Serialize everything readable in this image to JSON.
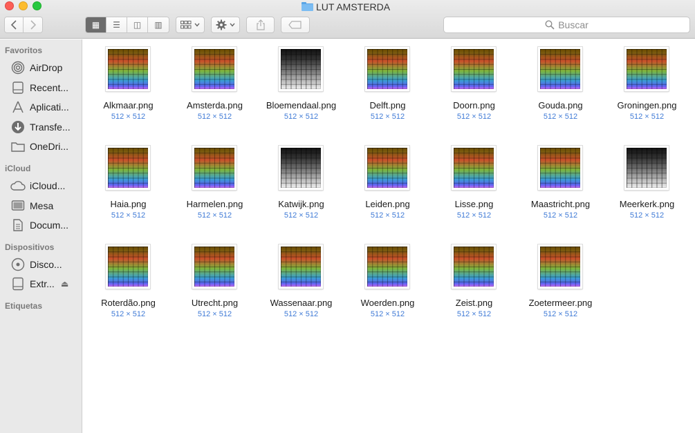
{
  "window": {
    "title": "LUT AMSTERDA",
    "folder_icon": "folder-icon"
  },
  "toolbar": {
    "back_icon": "chevron-left-icon",
    "forward_icon": "chevron-right-icon",
    "view_modes": [
      {
        "name": "icon-view",
        "glyph": "▦",
        "active": true
      },
      {
        "name": "list-view",
        "glyph": "☰",
        "active": false
      },
      {
        "name": "column-view",
        "glyph": "◫",
        "active": false
      },
      {
        "name": "cover-flow-view",
        "glyph": "▥",
        "active": false
      }
    ],
    "arrange_icon": "arrange-icon",
    "action_icon": "gear-icon",
    "share_icon": "share-icon",
    "tag_icon": "tag-icon",
    "search_placeholder": "Buscar",
    "search_icon": "search-icon"
  },
  "sidebar": {
    "sections": [
      {
        "label": "Favoritos",
        "items": [
          {
            "label": "AirDrop",
            "icon": "airdrop-icon"
          },
          {
            "label": "Recent...",
            "icon": "recents-icon"
          },
          {
            "label": "Aplicati...",
            "icon": "applications-icon"
          },
          {
            "label": "Transfe...",
            "icon": "downloads-icon"
          },
          {
            "label": "OneDri...",
            "icon": "folder-icon"
          }
        ]
      },
      {
        "label": "iCloud",
        "items": [
          {
            "label": "iCloud...",
            "icon": "cloud-icon"
          },
          {
            "label": "Mesa",
            "icon": "desktop-icon"
          },
          {
            "label": "Docum...",
            "icon": "documents-icon"
          }
        ]
      },
      {
        "label": "Dispositivos",
        "items": [
          {
            "label": "Disco...",
            "icon": "disk-icon"
          },
          {
            "label": "Extr...",
            "icon": "external-drive-icon",
            "eject": "⏏"
          }
        ]
      },
      {
        "label": "Etiquetas",
        "items": []
      }
    ]
  },
  "files": [
    {
      "name": "Alkmaar.png",
      "dims": "512 × 512",
      "tone": "color"
    },
    {
      "name": "Amsterda.png",
      "dims": "512 × 512",
      "tone": "color"
    },
    {
      "name": "Bloemendaal.png",
      "dims": "512 × 512",
      "tone": "gray"
    },
    {
      "name": "Delft.png",
      "dims": "512 × 512",
      "tone": "color"
    },
    {
      "name": "Doorn.png",
      "dims": "512 × 512",
      "tone": "color"
    },
    {
      "name": "Gouda.png",
      "dims": "512 × 512",
      "tone": "color"
    },
    {
      "name": "Groningen.png",
      "dims": "512 × 512",
      "tone": "color"
    },
    {
      "name": "Haia.png",
      "dims": "512 × 512",
      "tone": "color"
    },
    {
      "name": "Harmelen.png",
      "dims": "512 × 512",
      "tone": "color"
    },
    {
      "name": "Katwijk.png",
      "dims": "512 × 512",
      "tone": "gray"
    },
    {
      "name": "Leiden.png",
      "dims": "512 × 512",
      "tone": "color"
    },
    {
      "name": "Lisse.png",
      "dims": "512 × 512",
      "tone": "color"
    },
    {
      "name": "Maastricht.png",
      "dims": "512 × 512",
      "tone": "color"
    },
    {
      "name": "Meerkerk.png",
      "dims": "512 × 512",
      "tone": "gray"
    },
    {
      "name": "Roterdão.png",
      "dims": "512 × 512",
      "tone": "color"
    },
    {
      "name": "Utrecht.png",
      "dims": "512 × 512",
      "tone": "color"
    },
    {
      "name": "Wassenaar.png",
      "dims": "512 × 512",
      "tone": "color"
    },
    {
      "name": "Woerden.png",
      "dims": "512 × 512",
      "tone": "color"
    },
    {
      "name": "Zeist.png",
      "dims": "512 × 512",
      "tone": "color"
    },
    {
      "name": "Zoetermeer.png",
      "dims": "512 × 512",
      "tone": "color"
    }
  ],
  "colors": {
    "dims_text": "#3f7ad6",
    "sidebar_bg": "#e9e9e9",
    "close": "#fc5f57",
    "minimize": "#fdbc2e",
    "maximize": "#28c840"
  }
}
